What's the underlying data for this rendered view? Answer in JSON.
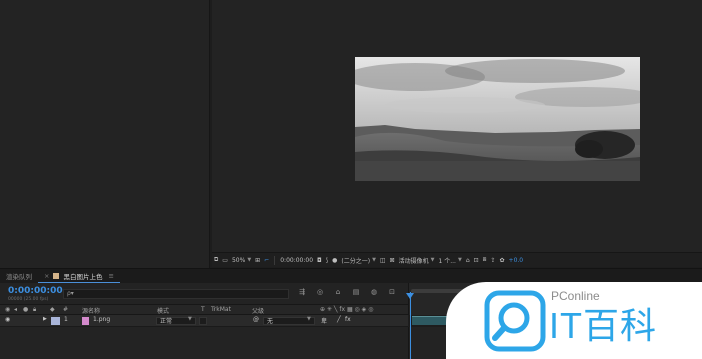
{
  "viewer": {
    "zoom": "50%",
    "timecode": "0:00:00:00",
    "resolution": "(二分之一)",
    "camera": "活动摄像机",
    "views": "1 个...",
    "exposure": "+0.0"
  },
  "tabs": [
    {
      "label": "渲染队列",
      "active": false
    },
    {
      "label": "黑白图片上色",
      "active": true
    }
  ],
  "timeline": {
    "timecode": "0:00:00:00",
    "subtimecode": "00000 (25.00 fps)",
    "search_placeholder": "ρ▾",
    "columns": {
      "num": "#",
      "source_name": "源名称",
      "mode": "模式",
      "t": "T",
      "trkmat": "TrkMat",
      "parent": "父级"
    },
    "layers": [
      {
        "index": "1",
        "name": "1.png",
        "mode": "正常",
        "parent": "无"
      }
    ]
  },
  "watermark": {
    "brand_en": "PConline",
    "brand_cn": "IT百科"
  },
  "colors": {
    "accent": "#3c8fe0",
    "background": "#1d1d1d",
    "panel": "#232323",
    "watermark_blue": "#2da6e8"
  }
}
